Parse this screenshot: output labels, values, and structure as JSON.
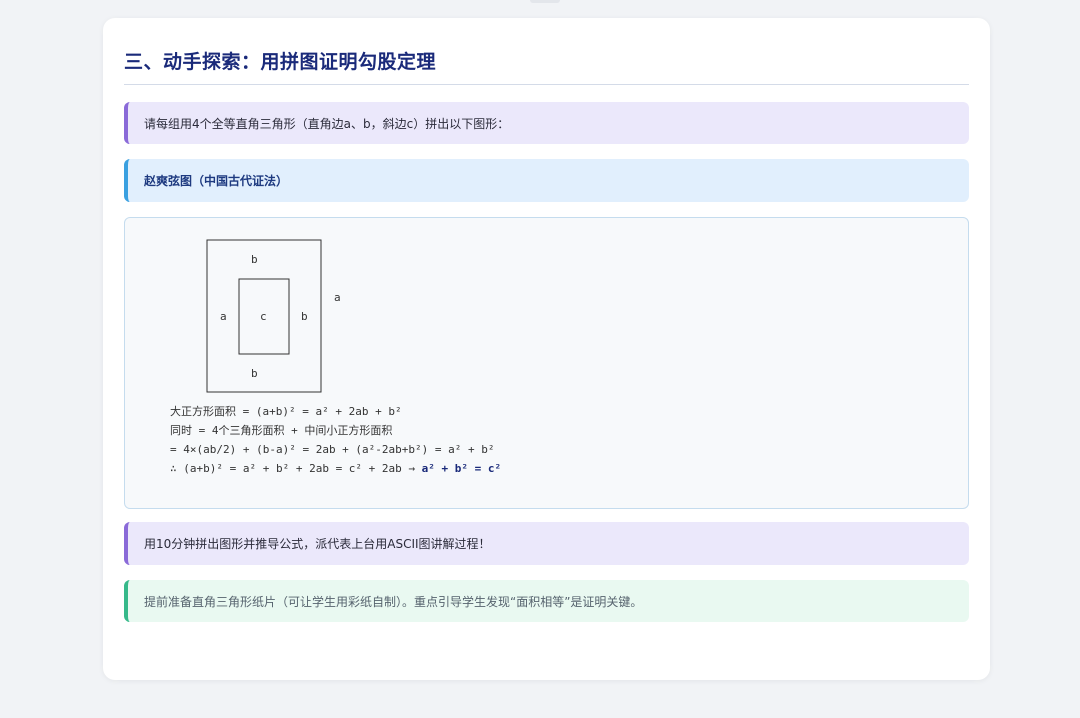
{
  "section": {
    "title": "三、动手探索：用拼图证明勾股定理"
  },
  "intro": {
    "text": "请每组用4个全等直角三角形（直角边a、b，斜边c）拼出以下图形："
  },
  "diagram_heading": {
    "text": "赵爽弦图（中国古代证法）"
  },
  "diagram": {
    "labels": {
      "top_b": "b",
      "outer_a": "a",
      "left_a": "a",
      "center_c": "c",
      "right_b": "b",
      "bottom_b": "b"
    },
    "formula_lines": {
      "line1": "大正方形面积 = (a+b)² = a² + 2ab + b²",
      "line2": "同时 = 4个三角形面积 + 中间小正方形面积",
      "line3": "= 4×(ab/2) + (b-a)² = 2ab + (a²-2ab+b²) = a² + b²",
      "line4_prefix": "∴ (a+b)² = a² + b² + 2ab = c² + 2ab → ",
      "line4_result": "a² + b² = c²"
    }
  },
  "task": {
    "text": "用10分钟拼出图形并推导公式，派代表上台用ASCII图讲解过程！"
  },
  "teacher_tip": {
    "text": "提前准备直角三角形纸片（可让学生用彩纸自制）。重点引导学生发现“面积相等”是证明关键。"
  },
  "colors": {
    "title": "#1a2a7a",
    "purple_accent": "#8a6ad8",
    "blue_accent": "#3aa0e0",
    "green_accent": "#36b98a"
  }
}
